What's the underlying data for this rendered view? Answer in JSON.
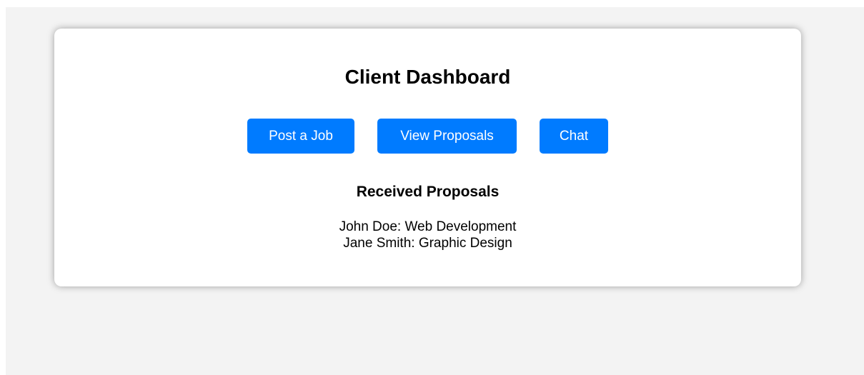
{
  "dashboard": {
    "title": "Client Dashboard",
    "buttons": {
      "post_job": "Post a Job",
      "view_proposals": "View Proposals",
      "chat": "Chat"
    },
    "proposals_heading": "Received Proposals",
    "proposals": [
      "John Doe: Web Development",
      "Jane Smith: Graphic Design"
    ]
  },
  "colors": {
    "accent": "#007bff",
    "page_background": "#f3f3f3",
    "card_background": "#ffffff"
  }
}
